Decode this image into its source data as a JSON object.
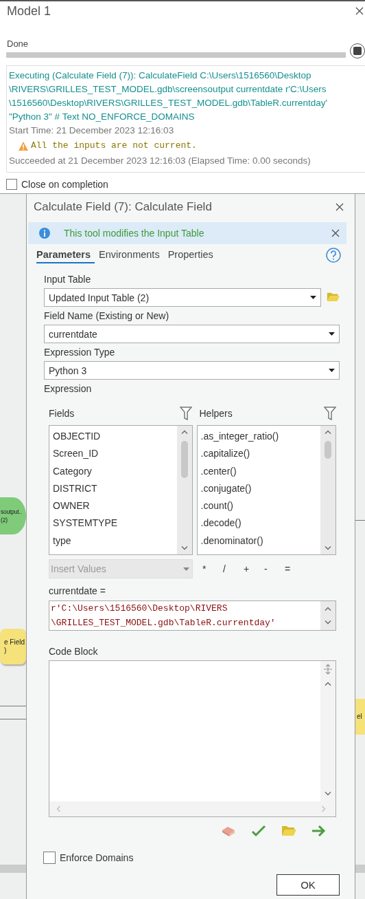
{
  "progress_window": {
    "title": "Model 1",
    "status": "Done",
    "progress": {
      "level": 1
    },
    "messages": [
      {
        "kind": "command",
        "lines": [
          "Executing (Calculate Field (7)): CalculateField C:\\Users\\1516560\\Desktop",
          "\\RIVERS\\GRILLES_TEST_MODEL.gdb\\screensoutput currentdate r'C:\\Users",
          "\\1516560\\Desktop\\RIVERS\\GRILLES_TEST_MODEL.gdb\\TableR.currentday'",
          "\"Python 3\" # Text NO_ENFORCE_DOMAINS"
        ]
      },
      {
        "kind": "info",
        "lines": [
          "Start Time: 21 December 2023 12:16:03"
        ]
      },
      {
        "kind": "warning",
        "lines": [
          "All the inputs are not current."
        ]
      },
      {
        "kind": "info",
        "lines": [
          "Succeeded at 21 December 2023 12:16:03 (Elapsed Time: 0.00 seconds)"
        ]
      }
    ],
    "close_on_completion": {
      "label": "Close on completion",
      "checked": false
    }
  },
  "canvas_nodes": [
    {
      "kind": "data",
      "lines": [
        "soutput..",
        "(2)"
      ]
    },
    {
      "kind": "tool",
      "lines": [
        "e Field",
        ")"
      ]
    },
    {
      "kind": "tool_right",
      "lines": [
        "el"
      ]
    }
  ],
  "tool_dialog": {
    "title": "Calculate Field (7): Calculate Field",
    "notice": "This tool modifies the Input Table",
    "tabs": [
      {
        "label": "Parameters",
        "selected": true
      },
      {
        "label": "Environments",
        "selected": false
      },
      {
        "label": "Properties",
        "selected": false
      }
    ],
    "input_table": {
      "label": "Input Table",
      "value": "Updated Input Table (2)"
    },
    "field_name": {
      "label": "Field Name (Existing or New)",
      "value": "currentdate"
    },
    "expression_type": {
      "label": "Expression Type",
      "value": "Python 3"
    },
    "expression": {
      "label": "Expression",
      "fields_header": "Fields",
      "helpers_header": "Helpers",
      "fields": [
        "OBJECTID",
        "Screen_ID",
        "Category",
        "DISTRICT",
        "OWNER",
        "SYSTEMTYPE",
        "type"
      ],
      "helpers": [
        ".as_integer_ratio()",
        ".capitalize()",
        ".center()",
        ".conjugate()",
        ".count()",
        ".decode()",
        ".denominator()"
      ],
      "insert_values": {
        "label": "Insert Values",
        "disabled": true
      },
      "operators": [
        "*",
        "/",
        "+",
        "-",
        "="
      ],
      "assignment_label": "currentdate =",
      "value_lines": [
        "r'C:\\Users\\1516560\\Desktop\\RIVERS",
        "\\GRILLES_TEST_MODEL.gdb\\TableR.currentday'"
      ]
    },
    "code_block": {
      "label": "Code Block"
    },
    "enforce_domains": {
      "label": "Enforce Domains",
      "checked": false
    },
    "ok_button": "OK"
  }
}
